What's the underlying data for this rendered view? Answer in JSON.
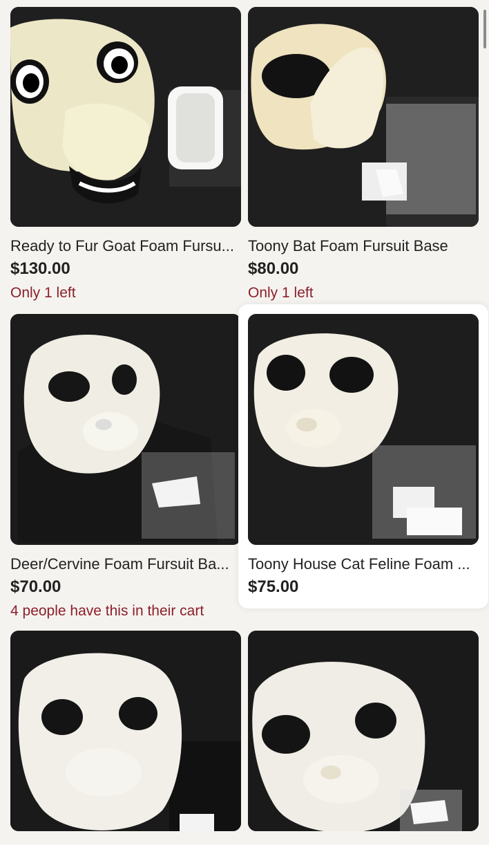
{
  "listings": [
    {
      "title": "Ready to Fur Goat Foam Fursu...",
      "price": "$130.00",
      "note": "Only 1 left",
      "image_icon": "goat-fursuit-base-photo"
    },
    {
      "title": "Toony Bat Foam Fursuit Base",
      "price": "$80.00",
      "note": "Only 1 left",
      "image_icon": "bat-fursuit-base-photo"
    },
    {
      "title": "Deer/Cervine Foam Fursuit Ba...",
      "price": "$70.00",
      "note": "4 people have this in their cart",
      "image_icon": "deer-fursuit-base-photo"
    },
    {
      "title": "Toony House Cat Feline Foam ...",
      "price": "$75.00",
      "note": "",
      "image_icon": "cat-fursuit-base-photo"
    },
    {
      "title": "",
      "price": "",
      "note": "",
      "image_icon": "foam-fursuit-base-photo"
    },
    {
      "title": "",
      "price": "",
      "note": "",
      "image_icon": "foam-fursuit-base-photo"
    }
  ],
  "colors": {
    "background": "#f5f3ef",
    "note": "#8a1f2c",
    "text": "#222222"
  }
}
